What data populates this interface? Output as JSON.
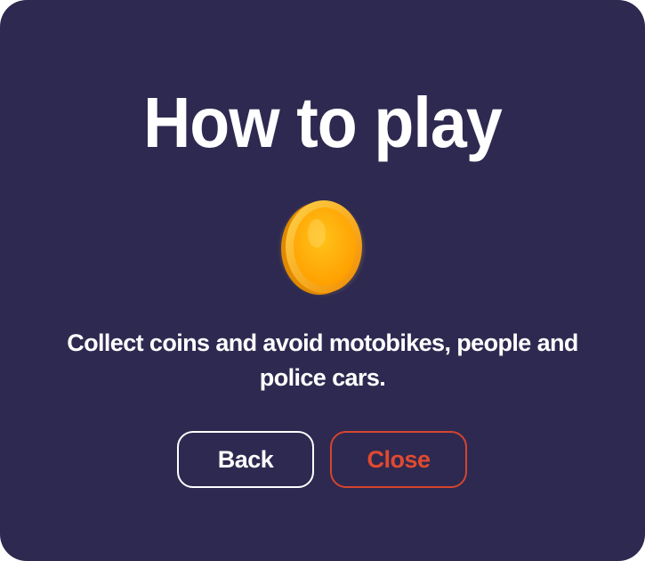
{
  "dialog": {
    "title": "How to play",
    "icon": "coin-icon",
    "instructions": "Collect coins and avoid motobikes, people and police cars.",
    "buttons": {
      "back_label": "Back",
      "close_label": "Close"
    }
  },
  "colors": {
    "background": "#2e2950",
    "text": "#ffffff",
    "close_accent": "#e04a30",
    "coin": "#ffb300"
  }
}
